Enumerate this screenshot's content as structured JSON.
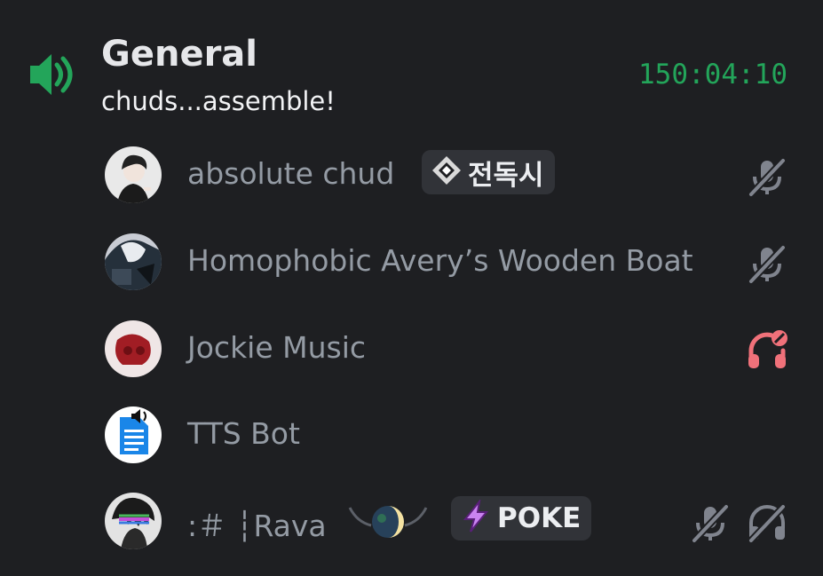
{
  "channel": {
    "name": "General",
    "status": "chuds...assemble!",
    "elapsed": "150:04:10"
  },
  "colors": {
    "background": "#1e1f22",
    "accent_green": "#23a55a",
    "muted_text": "#949ba4",
    "deafened_red": "#f0717a",
    "tag_background": "#313338"
  },
  "members": [
    {
      "name": "absolute chud",
      "tag": "전독시",
      "tag_icon": "diamond-sparkle-icon",
      "status_icons": [
        "muted-microphone-icon"
      ]
    },
    {
      "name": "Homophobic Avery’s Wooden Boat",
      "status_icons": [
        "muted-microphone-icon"
      ]
    },
    {
      "name": "Jockie Music",
      "status_icons": [
        "deafened-headphones-icon"
      ]
    },
    {
      "name": "TTS Bot",
      "status_icons": []
    },
    {
      "name": ":＃ ┆Rava",
      "tag": "POKE",
      "tag_icon": "lightning-bolt-icon",
      "status_icons": [
        "muted-microphone-icon",
        "deafened-headphones-icon"
      ]
    }
  ]
}
